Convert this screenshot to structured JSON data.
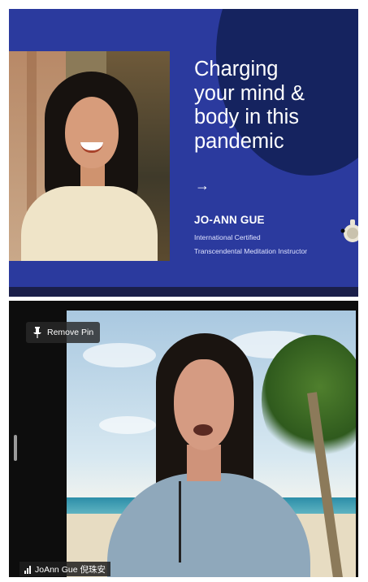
{
  "slide": {
    "title": "Charging\nyour mind &\nbody in this\npandemic",
    "arrow_glyph": "→",
    "speaker_name": "JO-ANN GUE",
    "speaker_role_line1": "International Certified",
    "speaker_role_line2": "Transcendental Meditation Instructor"
  },
  "video": {
    "pin_button_label": "Remove Pin",
    "participant_name": "JoAnn Gue 倪珠安",
    "icons": {
      "pin": "pin-icon",
      "signal": "signal-strength-icon"
    }
  },
  "colors": {
    "slide_background": "#2b3a9e",
    "slide_accent_circle": "#15235f",
    "video_background": "#0d0d0d"
  }
}
